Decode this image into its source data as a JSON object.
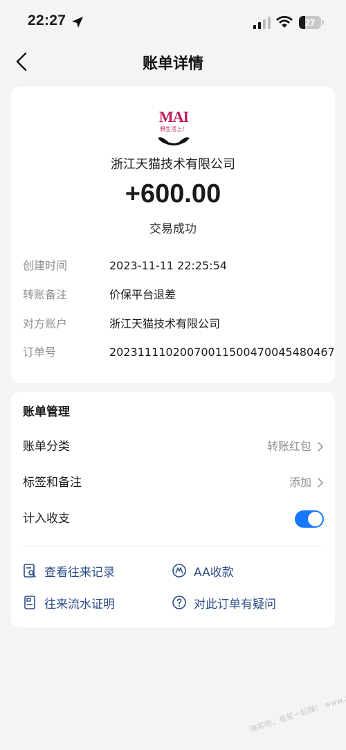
{
  "status_bar": {
    "time": "22:27",
    "battery": "27",
    "battery_level": 0.27
  },
  "nav": {
    "title": "账单详情"
  },
  "merchant": {
    "logo_word": "MAI",
    "logo_slogan": "想生活上！",
    "name": "浙江天猫技术有限公司",
    "amount": "+600.00",
    "status": "交易成功"
  },
  "details": [
    {
      "label": "创建时间",
      "value": "2023-11-11 22:25:54"
    },
    {
      "label": "转账备注",
      "value": "价保平台退差"
    },
    {
      "label": "对方账户",
      "value": "浙江天猫技术有限公司"
    },
    {
      "label": "订单号",
      "value": "2023111102007001150047004548046​7"
    }
  ],
  "management": {
    "title": "账单管理",
    "category": {
      "label": "账单分类",
      "value": "转账红包"
    },
    "tags": {
      "label": "标签和备注",
      "value": "添加"
    },
    "include": {
      "label": "计入收支",
      "on": true
    }
  },
  "actions": {
    "history": "查看往来记录",
    "aa": "AA收款",
    "proof": "往来流水证明",
    "question": "对此订单有疑问"
  },
  "watermark": "赚客吧，有奖一起赚！ www.zuanke8.com",
  "colors": {
    "accent": "#1677ff",
    "link": "#2b4b88",
    "logo": "#c2185b"
  }
}
